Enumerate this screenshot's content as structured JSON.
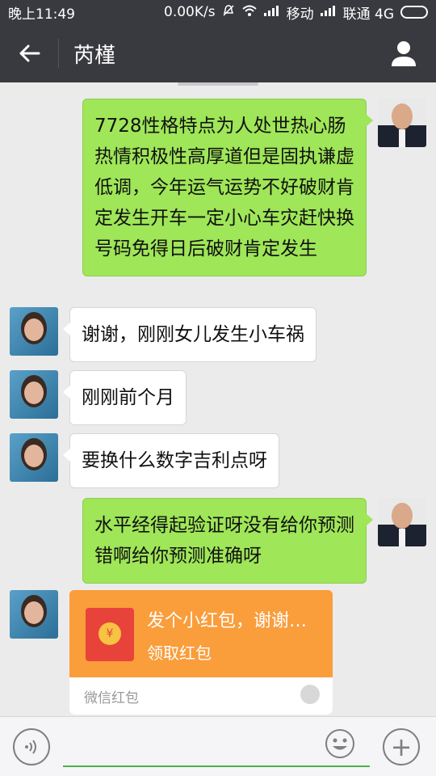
{
  "status_bar": {
    "time": "晚上11:49",
    "speed": "0.00K/s",
    "carrier1": "移动",
    "carrier2": "联通 4G"
  },
  "header": {
    "title": "芮槿",
    "back_icon": "arrow-left-icon",
    "profile_icon": "person-icon"
  },
  "messages": [
    {
      "sender": "me",
      "text": "7728性格特点为人处世热心肠热情积极性高厚道但是固执谦虚低调，今年运气运势不好破财肯定发生开车一定小心车灾赶快换号码免得日后破财肯定发生"
    },
    {
      "sender": "contact",
      "text": "谢谢，刚刚女儿发生小车祸"
    },
    {
      "sender": "contact",
      "text": "刚刚前个月"
    },
    {
      "sender": "contact",
      "text": "要换什么数字吉利点呀"
    },
    {
      "sender": "me",
      "text": "水平经得起验证呀没有给你预测错啊给你预测准确呀"
    }
  ],
  "red_packet": {
    "title": "发个小红包，谢谢老…",
    "action": "领取红包",
    "label": "微信红包",
    "coin_symbol": "¥",
    "color": "#fa9d3b"
  },
  "input_bar": {
    "voice_icon": "voice-icon",
    "emoji_icon": "emoji-icon",
    "plus_icon": "plus-icon",
    "plus_symbol": "+"
  },
  "colors": {
    "header_bg": "#393a3f",
    "my_bubble": "#9fe658",
    "chat_bg": "#ebebeb",
    "accent": "#4cb14a"
  }
}
